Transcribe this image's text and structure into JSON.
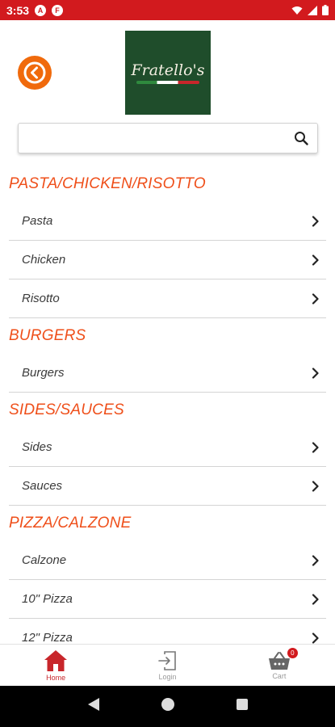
{
  "status_bar": {
    "time": "3:53",
    "notifications": [
      "A",
      "F"
    ],
    "bg_color": "#d21a1e"
  },
  "header": {
    "logo_text": "Fratello's",
    "back_icon": "arrow-left-icon",
    "accent": "#f06a0c"
  },
  "search": {
    "value": "",
    "placeholder": "",
    "icon": "search-icon"
  },
  "menu": {
    "title_color": "#ef4f1a",
    "categories": [
      {
        "title": "PASTA/CHICKEN/RISOTTO",
        "items": [
          "Pasta",
          "Chicken",
          "Risotto"
        ]
      },
      {
        "title": "BURGERS",
        "items": [
          "Burgers"
        ]
      },
      {
        "title": "SIDES/SAUCES",
        "items": [
          "Sides",
          "Sauces"
        ]
      },
      {
        "title": "PIZZA/CALZONE",
        "items": [
          "Calzone",
          "10\" Pizza",
          "12\" Pizza"
        ]
      }
    ]
  },
  "bottom_nav": {
    "items": [
      {
        "label": "Home",
        "icon": "home-icon",
        "active": true
      },
      {
        "label": "Login",
        "icon": "login-icon",
        "active": false
      },
      {
        "label": "Cart",
        "icon": "cart-icon",
        "active": false
      }
    ],
    "cart_count": "0",
    "active_color": "#c8262b"
  },
  "android_nav": [
    "back-icon",
    "home-circle-icon",
    "recents-icon"
  ]
}
